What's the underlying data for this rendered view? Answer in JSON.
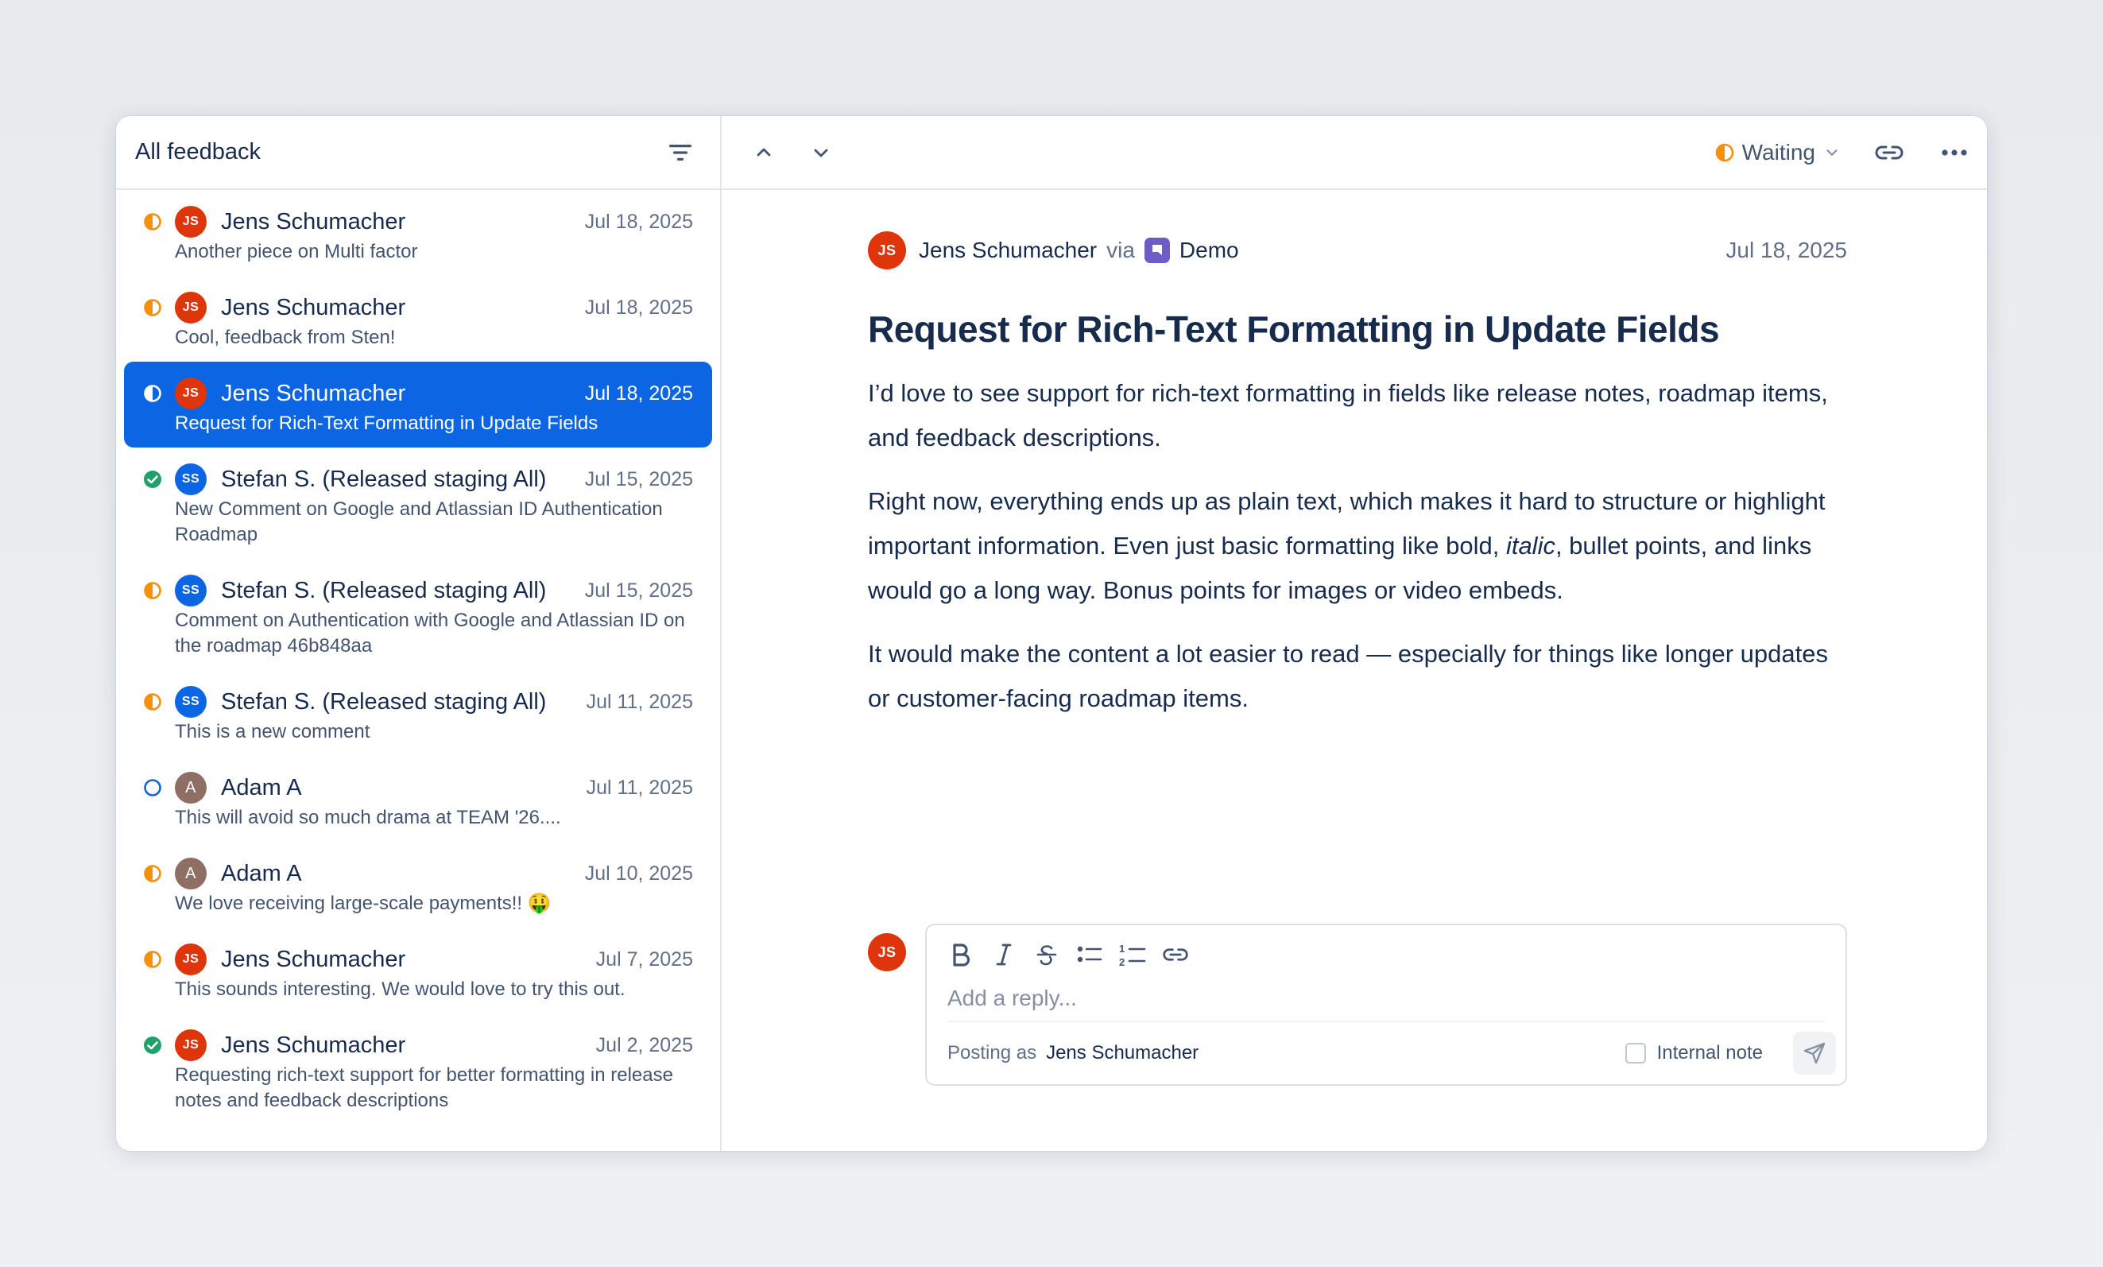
{
  "sidebar": {
    "title": "All feedback",
    "items": [
      {
        "status": "waiting",
        "initials": "JS",
        "avatar_color": "red",
        "name": "Jens Schumacher",
        "date": "Jul 18, 2025",
        "preview": "Another piece on Multi factor"
      },
      {
        "status": "waiting",
        "initials": "JS",
        "avatar_color": "red",
        "name": "Jens Schumacher",
        "date": "Jul 18, 2025",
        "preview": "Cool, feedback from Sten!"
      },
      {
        "status": "waiting",
        "initials": "JS",
        "avatar_color": "red",
        "name": "Jens Schumacher",
        "date": "Jul 18, 2025",
        "preview": "Request for Rich-Text Formatting in Update Fields",
        "selected": true
      },
      {
        "status": "done",
        "initials": "SS",
        "avatar_color": "blue",
        "name": "Stefan S. (Released staging All)",
        "date": "Jul 15, 2025",
        "preview": "New Comment on Google and Atlassian ID Authentication Roadmap"
      },
      {
        "status": "waiting",
        "initials": "SS",
        "avatar_color": "blue",
        "name": "Stefan S. (Released staging All)",
        "date": "Jul 15, 2025",
        "preview": "Comment on Authentication with Google and Atlassian ID on the roadmap 46b848aa"
      },
      {
        "status": "waiting",
        "initials": "SS",
        "avatar_color": "blue",
        "name": "Stefan S. (Released staging All)",
        "date": "Jul 11, 2025",
        "preview": "This is a new comment"
      },
      {
        "status": "open",
        "initials": "A",
        "avatar_color": "brown",
        "name": "Adam A",
        "date": "Jul 11, 2025",
        "preview": "This will avoid so much drama at TEAM '26...."
      },
      {
        "status": "waiting",
        "initials": "A",
        "avatar_color": "brown",
        "name": "Adam A",
        "date": "Jul 10, 2025",
        "preview": "We love receiving large-scale payments!! 🤑"
      },
      {
        "status": "waiting",
        "initials": "JS",
        "avatar_color": "red",
        "name": "Jens Schumacher",
        "date": "Jul 7, 2025",
        "preview": "This sounds interesting. We would love to try this out."
      },
      {
        "status": "done",
        "initials": "JS",
        "avatar_color": "red",
        "name": "Jens Schumacher",
        "date": "Jul 2, 2025",
        "preview": "Requesting rich-text support for better formatting in release notes and feedback descriptions"
      }
    ]
  },
  "header": {
    "status_label": "Waiting"
  },
  "detail": {
    "author_initials": "JS",
    "author": "Jens Schumacher",
    "via": "via",
    "source": "Demo",
    "date": "Jul 18, 2025",
    "title": "Request for Rich-Text Formatting in Update Fields",
    "p1": "I’d love to see support for rich-text formatting in fields like release notes, roadmap items, and feedback descriptions.",
    "p2_a": "Right now, everything ends up as plain text, which makes it hard to structure or highlight important information. Even just basic formatting like bold, ",
    "p2_italic": "italic",
    "p2_b": ", bullet points, and links would go a long way. Bonus points for images or video embeds.",
    "p3": "It would make the content a lot easier to read — especially for things like longer updates or customer-facing roadmap items."
  },
  "reply": {
    "avatar_initials": "JS",
    "placeholder": "Add a reply...",
    "posting_as_label": "Posting as",
    "posting_as_name": "Jens Schumacher",
    "internal_note_label": "Internal note"
  },
  "colors": {
    "accent": "#0c66e4",
    "waiting": "#f79009",
    "done": "#22a06b",
    "avatar_red": "#de350b",
    "avatar_blue": "#0c66e4",
    "avatar_brown": "#8f6e63",
    "demo_brand": "#6e5dc6"
  }
}
